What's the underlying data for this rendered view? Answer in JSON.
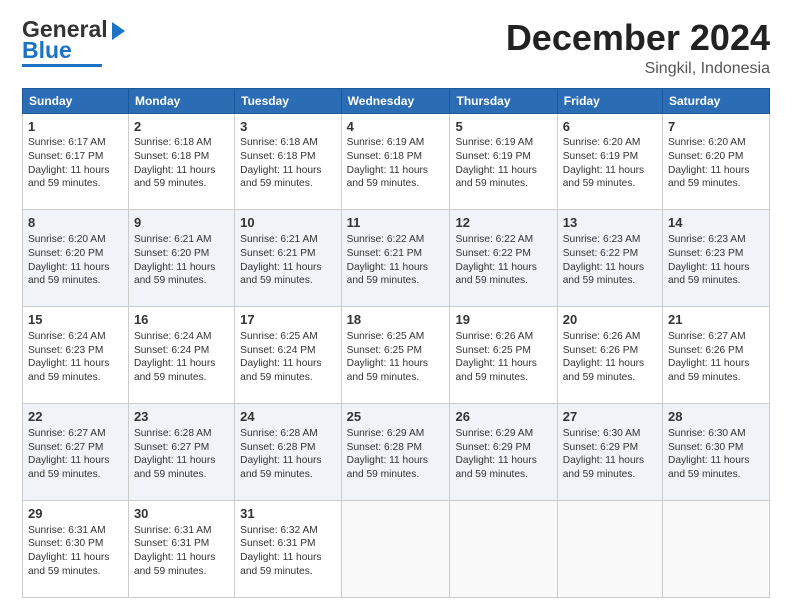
{
  "header": {
    "logo_line1": "General",
    "logo_line2": "Blue",
    "month": "December 2024",
    "location": "Singkil, Indonesia"
  },
  "days_of_week": [
    "Sunday",
    "Monday",
    "Tuesday",
    "Wednesday",
    "Thursday",
    "Friday",
    "Saturday"
  ],
  "weeks": [
    [
      {
        "day": 1,
        "sunrise": "6:17 AM",
        "sunset": "6:17 PM",
        "daylight": "11 hours and 59 minutes."
      },
      {
        "day": 2,
        "sunrise": "6:18 AM",
        "sunset": "6:18 PM",
        "daylight": "11 hours and 59 minutes."
      },
      {
        "day": 3,
        "sunrise": "6:18 AM",
        "sunset": "6:18 PM",
        "daylight": "11 hours and 59 minutes."
      },
      {
        "day": 4,
        "sunrise": "6:19 AM",
        "sunset": "6:18 PM",
        "daylight": "11 hours and 59 minutes."
      },
      {
        "day": 5,
        "sunrise": "6:19 AM",
        "sunset": "6:19 PM",
        "daylight": "11 hours and 59 minutes."
      },
      {
        "day": 6,
        "sunrise": "6:20 AM",
        "sunset": "6:19 PM",
        "daylight": "11 hours and 59 minutes."
      },
      {
        "day": 7,
        "sunrise": "6:20 AM",
        "sunset": "6:20 PM",
        "daylight": "11 hours and 59 minutes."
      }
    ],
    [
      {
        "day": 8,
        "sunrise": "6:20 AM",
        "sunset": "6:20 PM",
        "daylight": "11 hours and 59 minutes."
      },
      {
        "day": 9,
        "sunrise": "6:21 AM",
        "sunset": "6:20 PM",
        "daylight": "11 hours and 59 minutes."
      },
      {
        "day": 10,
        "sunrise": "6:21 AM",
        "sunset": "6:21 PM",
        "daylight": "11 hours and 59 minutes."
      },
      {
        "day": 11,
        "sunrise": "6:22 AM",
        "sunset": "6:21 PM",
        "daylight": "11 hours and 59 minutes."
      },
      {
        "day": 12,
        "sunrise": "6:22 AM",
        "sunset": "6:22 PM",
        "daylight": "11 hours and 59 minutes."
      },
      {
        "day": 13,
        "sunrise": "6:23 AM",
        "sunset": "6:22 PM",
        "daylight": "11 hours and 59 minutes."
      },
      {
        "day": 14,
        "sunrise": "6:23 AM",
        "sunset": "6:23 PM",
        "daylight": "11 hours and 59 minutes."
      }
    ],
    [
      {
        "day": 15,
        "sunrise": "6:24 AM",
        "sunset": "6:23 PM",
        "daylight": "11 hours and 59 minutes."
      },
      {
        "day": 16,
        "sunrise": "6:24 AM",
        "sunset": "6:24 PM",
        "daylight": "11 hours and 59 minutes."
      },
      {
        "day": 17,
        "sunrise": "6:25 AM",
        "sunset": "6:24 PM",
        "daylight": "11 hours and 59 minutes."
      },
      {
        "day": 18,
        "sunrise": "6:25 AM",
        "sunset": "6:25 PM",
        "daylight": "11 hours and 59 minutes."
      },
      {
        "day": 19,
        "sunrise": "6:26 AM",
        "sunset": "6:25 PM",
        "daylight": "11 hours and 59 minutes."
      },
      {
        "day": 20,
        "sunrise": "6:26 AM",
        "sunset": "6:26 PM",
        "daylight": "11 hours and 59 minutes."
      },
      {
        "day": 21,
        "sunrise": "6:27 AM",
        "sunset": "6:26 PM",
        "daylight": "11 hours and 59 minutes."
      }
    ],
    [
      {
        "day": 22,
        "sunrise": "6:27 AM",
        "sunset": "6:27 PM",
        "daylight": "11 hours and 59 minutes."
      },
      {
        "day": 23,
        "sunrise": "6:28 AM",
        "sunset": "6:27 PM",
        "daylight": "11 hours and 59 minutes."
      },
      {
        "day": 24,
        "sunrise": "6:28 AM",
        "sunset": "6:28 PM",
        "daylight": "11 hours and 59 minutes."
      },
      {
        "day": 25,
        "sunrise": "6:29 AM",
        "sunset": "6:28 PM",
        "daylight": "11 hours and 59 minutes."
      },
      {
        "day": 26,
        "sunrise": "6:29 AM",
        "sunset": "6:29 PM",
        "daylight": "11 hours and 59 minutes."
      },
      {
        "day": 27,
        "sunrise": "6:30 AM",
        "sunset": "6:29 PM",
        "daylight": "11 hours and 59 minutes."
      },
      {
        "day": 28,
        "sunrise": "6:30 AM",
        "sunset": "6:30 PM",
        "daylight": "11 hours and 59 minutes."
      }
    ],
    [
      {
        "day": 29,
        "sunrise": "6:31 AM",
        "sunset": "6:30 PM",
        "daylight": "11 hours and 59 minutes."
      },
      {
        "day": 30,
        "sunrise": "6:31 AM",
        "sunset": "6:31 PM",
        "daylight": "11 hours and 59 minutes."
      },
      {
        "day": 31,
        "sunrise": "6:32 AM",
        "sunset": "6:31 PM",
        "daylight": "11 hours and 59 minutes."
      },
      null,
      null,
      null,
      null
    ]
  ]
}
